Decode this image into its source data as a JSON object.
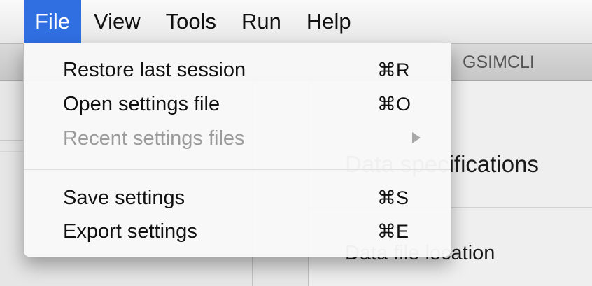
{
  "menubar": {
    "items": [
      "File",
      "View",
      "Tools",
      "Run",
      "Help"
    ]
  },
  "window": {
    "tab_label": "GSIMCLI",
    "section_title": "Data specifications",
    "field_label": "Data file location"
  },
  "file_menu": {
    "items": [
      {
        "label": "Restore last session",
        "shortcut": "⌘R",
        "enabled": true
      },
      {
        "label": "Open settings file",
        "shortcut": "⌘O",
        "enabled": true
      },
      {
        "label": "Recent settings files",
        "submenu": true,
        "enabled": false
      },
      {
        "label": "Save settings",
        "shortcut": "⌘S",
        "enabled": true
      },
      {
        "label": "Export settings",
        "shortcut": "⌘E",
        "enabled": true
      }
    ]
  },
  "colors": {
    "menu_highlight": "#2f6fe2",
    "disabled_text": "#9b9b9b"
  },
  "icons": {
    "submenu_indicator": "submenu-arrow-icon"
  }
}
